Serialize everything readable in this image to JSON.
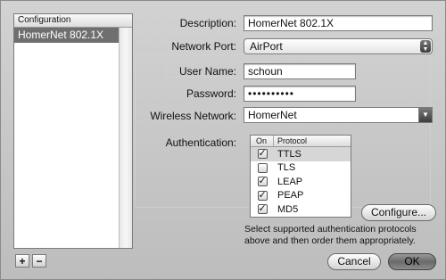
{
  "configurations": {
    "header": "Configuration",
    "items": [
      {
        "label": "HomerNet 802.1X",
        "selected": true
      }
    ],
    "add_label": "+",
    "remove_label": "−"
  },
  "form": {
    "description": {
      "label": "Description:",
      "value": "HomerNet 802.1X"
    },
    "network_port": {
      "label": "Network Port:",
      "value": "AirPort"
    },
    "user_name": {
      "label": "User Name:",
      "value": "schoun"
    },
    "password": {
      "label": "Password:",
      "value": "••••••••••"
    },
    "wireless_network": {
      "label": "Wireless Network:",
      "value": "HomerNet"
    },
    "authentication": {
      "label": "Authentication:",
      "columns": {
        "on": "On",
        "protocol": "Protocol"
      },
      "protocols": [
        {
          "name": "TTLS",
          "on": true,
          "selected": true
        },
        {
          "name": "TLS",
          "on": false,
          "selected": false
        },
        {
          "name": "LEAP",
          "on": true,
          "selected": false
        },
        {
          "name": "PEAP",
          "on": true,
          "selected": false
        },
        {
          "name": "MD5",
          "on": true,
          "selected": false
        }
      ]
    }
  },
  "buttons": {
    "configure": "Configure...",
    "cancel": "Cancel",
    "ok": "OK"
  },
  "hint": "Select supported authentication protocols above and then order them appropriately.",
  "colors": {
    "selection_dark": "#6f6f6f",
    "selection_light": "#d6d6d6"
  }
}
